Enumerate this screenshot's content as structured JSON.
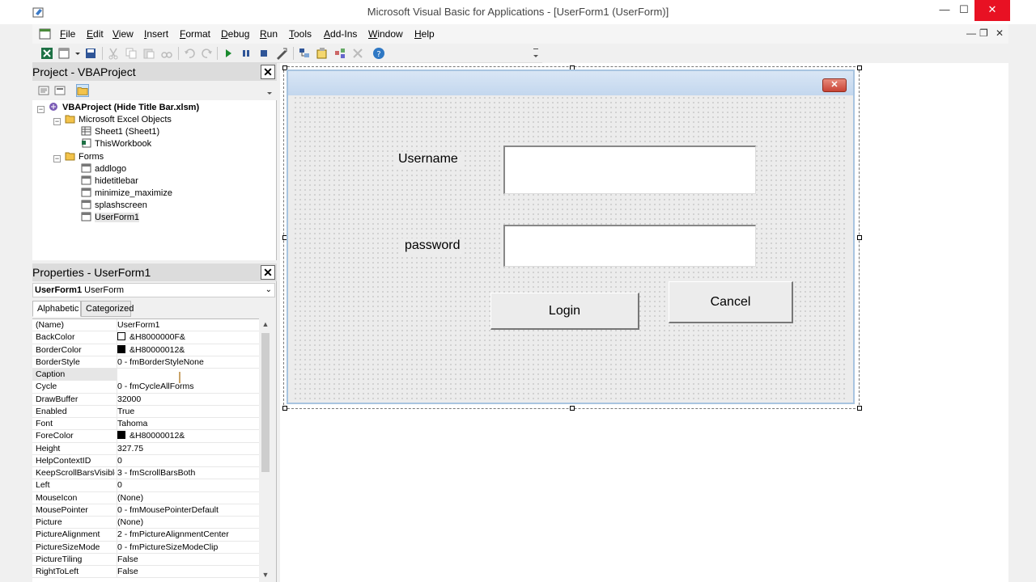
{
  "window": {
    "title": "Microsoft Visual Basic for Applications - [UserForm1 (UserForm)]",
    "minimize": "—",
    "maximize": "☐",
    "close": "✕"
  },
  "menubar": {
    "items": [
      "File",
      "Edit",
      "View",
      "Insert",
      "Format",
      "Debug",
      "Run",
      "Tools",
      "Add-Ins",
      "Window",
      "Help"
    ],
    "mdi_minimize": "—",
    "mdi_restore": "❐",
    "mdi_close": "✕"
  },
  "project": {
    "title": "Project - VBAProject",
    "close": "✕",
    "tree": {
      "root": "VBAProject (Hide Title Bar.xlsm)",
      "excel_objects": "Microsoft Excel Objects",
      "sheet1": "Sheet1 (Sheet1)",
      "thisworkbook": "ThisWorkbook",
      "forms": "Forms",
      "form_items": [
        "addlogo",
        "hidetitlebar",
        "minimize_maximize",
        "splashscreen",
        "UserForm1"
      ]
    }
  },
  "properties": {
    "title": "Properties - UserForm1",
    "close": "✕",
    "object_name": "UserForm1",
    "object_type": "UserForm",
    "tabs": [
      "Alphabetic",
      "Categorized"
    ],
    "rows": [
      {
        "name": "(Name)",
        "value": "UserForm1"
      },
      {
        "name": "BackColor",
        "value": "&H8000000F&",
        "swatch": "#ffffff"
      },
      {
        "name": "BorderColor",
        "value": "&H80000012&",
        "swatch": "#000000"
      },
      {
        "name": "BorderStyle",
        "value": "0 - fmBorderStyleNone"
      },
      {
        "name": "Caption",
        "value": ""
      },
      {
        "name": "Cycle",
        "value": "0 - fmCycleAllForms"
      },
      {
        "name": "DrawBuffer",
        "value": "32000"
      },
      {
        "name": "Enabled",
        "value": "True"
      },
      {
        "name": "Font",
        "value": "Tahoma"
      },
      {
        "name": "ForeColor",
        "value": "&H80000012&",
        "swatch": "#000000"
      },
      {
        "name": "Height",
        "value": "327.75"
      },
      {
        "name": "HelpContextID",
        "value": "0"
      },
      {
        "name": "KeepScrollBarsVisible",
        "value": "3 - fmScrollBarsBoth"
      },
      {
        "name": "Left",
        "value": "0"
      },
      {
        "name": "MouseIcon",
        "value": "(None)"
      },
      {
        "name": "MousePointer",
        "value": "0 - fmMousePointerDefault"
      },
      {
        "name": "Picture",
        "value": "(None)"
      },
      {
        "name": "PictureAlignment",
        "value": "2 - fmPictureAlignmentCenter"
      },
      {
        "name": "PictureSizeMode",
        "value": "0 - fmPictureSizeModeClip"
      },
      {
        "name": "PictureTiling",
        "value": "False"
      },
      {
        "name": "RightToLeft",
        "value": "False"
      }
    ]
  },
  "userform": {
    "close": "✕",
    "username_label": "Username",
    "password_label": "password",
    "login_button": "Login",
    "cancel_button": "Cancel"
  },
  "colors": {
    "selection": "#e6e6e6",
    "pane_title": "#dcdcdc",
    "form_caption": "#c3d7ee",
    "form_close": "#c84436"
  }
}
